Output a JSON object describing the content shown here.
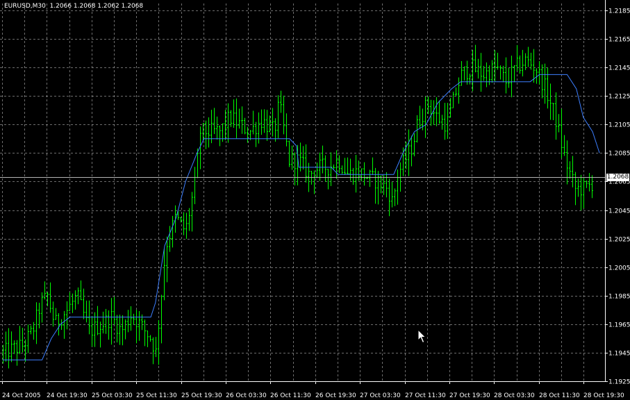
{
  "header": {
    "symbol": "EURUSD,M30",
    "ohlc": "1.2066 1.2068 1.2062 1.2068"
  },
  "current_price": "1.2068",
  "colors": {
    "background": "#000000",
    "grid": "#c8c8c8",
    "bars": "#00ff00",
    "moving_average": "#3d7fff",
    "bid_line": "#b4b4b4",
    "axis_text": "#ffffff"
  },
  "icons": [
    "mouse-cursor-icon"
  ],
  "chart_data": {
    "type": "line",
    "symbol": "EURUSD",
    "timeframe": "M30",
    "grid": true,
    "ylim": [
      1.1925,
      1.2185
    ],
    "y_ticks": [
      "1.2185",
      "1.2165",
      "1.2145",
      "1.2125",
      "1.2105",
      "1.2085",
      "1.2065",
      "1.2045",
      "1.2025",
      "1.2005",
      "1.1985",
      "1.1965",
      "1.1945",
      "1.1925"
    ],
    "x_ticks": [
      "24 Oct 2005",
      "24 Oct 19:30",
      "25 Oct 03:30",
      "25 Oct 11:30",
      "25 Oct 19:30",
      "26 Oct 03:30",
      "26 Oct 11:30",
      "26 Oct 19:30",
      "27 Oct 03:30",
      "27 Oct 11:30",
      "27 Oct 19:30",
      "28 Oct 03:30",
      "28 Oct 11:30",
      "28 Oct 19:30"
    ],
    "series": [
      {
        "style": "ohlc-bars",
        "color": "#00ff00",
        "bar_count": 213,
        "anchors": [
          [
            0,
            1.1945
          ],
          [
            8,
            1.195
          ],
          [
            12,
            1.196
          ],
          [
            15,
            1.1978
          ],
          [
            18,
            1.1985
          ],
          [
            21,
            1.1965
          ],
          [
            26,
            1.1975
          ],
          [
            30,
            1.1985
          ],
          [
            35,
            1.196
          ],
          [
            40,
            1.1965
          ],
          [
            44,
            1.197
          ],
          [
            48,
            1.196
          ],
          [
            52,
            1.1972
          ],
          [
            55,
            1.1966
          ],
          [
            60,
            1.1955
          ],
          [
            62,
            1.1945
          ],
          [
            66,
            1.202
          ],
          [
            70,
            1.204
          ],
          [
            74,
            1.203
          ],
          [
            78,
            1.2065
          ],
          [
            80,
            1.21
          ],
          [
            88,
            1.21
          ],
          [
            92,
            1.211
          ],
          [
            100,
            1.21
          ],
          [
            105,
            1.2108
          ],
          [
            110,
            1.21
          ],
          [
            112,
            1.212
          ],
          [
            116,
            1.208
          ],
          [
            120,
            1.208
          ],
          [
            124,
            1.207
          ],
          [
            128,
            1.2075
          ],
          [
            132,
            1.2075
          ],
          [
            136,
            1.208
          ],
          [
            140,
            1.207
          ],
          [
            144,
            1.2072
          ],
          [
            148,
            1.2068
          ],
          [
            152,
            1.2065
          ],
          [
            156,
            1.206
          ],
          [
            158,
            1.205
          ],
          [
            160,
            1.207
          ],
          [
            163,
            1.208
          ],
          [
            166,
            1.209
          ],
          [
            168,
            1.2105
          ],
          [
            172,
            1.212
          ],
          [
            176,
            1.211
          ],
          [
            180,
            1.2105
          ],
          [
            184,
            1.213
          ],
          [
            186,
            1.214
          ],
          [
            190,
            1.2145
          ],
          [
            195,
            1.214
          ],
          [
            200,
            1.2145
          ],
          [
            204,
            1.2135
          ],
          [
            208,
            1.2145
          ],
          [
            212,
            1.215
          ],
          [
            216,
            1.2145
          ],
          [
            220,
            1.213
          ],
          [
            224,
            1.211
          ],
          [
            228,
            1.208
          ],
          [
            232,
            1.206
          ],
          [
            236,
            1.206
          ],
          [
            240,
            1.2065
          ]
        ]
      },
      {
        "style": "line",
        "color": "#3d7fff",
        "points": [
          [
            0,
            1.194
          ],
          [
            17,
            1.194
          ],
          [
            21,
            1.1955
          ],
          [
            25,
            1.1965
          ],
          [
            29,
            1.197
          ],
          [
            64,
            1.197
          ],
          [
            66,
            1.198
          ],
          [
            70,
            1.202
          ],
          [
            75,
            1.204
          ],
          [
            79,
            1.2065
          ],
          [
            84,
            1.2085
          ],
          [
            87,
            1.2095
          ],
          [
            124,
            1.2095
          ],
          [
            127,
            1.209
          ],
          [
            128,
            1.2075
          ],
          [
            142,
            1.2075
          ],
          [
            145,
            1.207
          ],
          [
            169,
            1.207
          ],
          [
            173,
            1.2085
          ],
          [
            178,
            1.21
          ],
          [
            183,
            1.2105
          ],
          [
            188,
            1.212
          ],
          [
            194,
            1.213
          ],
          [
            198,
            1.2135
          ],
          [
            228,
            1.2135
          ],
          [
            232,
            1.214
          ],
          [
            244,
            1.214
          ],
          [
            248,
            1.213
          ],
          [
            251,
            1.211
          ],
          [
            255,
            1.21
          ],
          [
            258,
            1.2085
          ]
        ]
      }
    ]
  }
}
